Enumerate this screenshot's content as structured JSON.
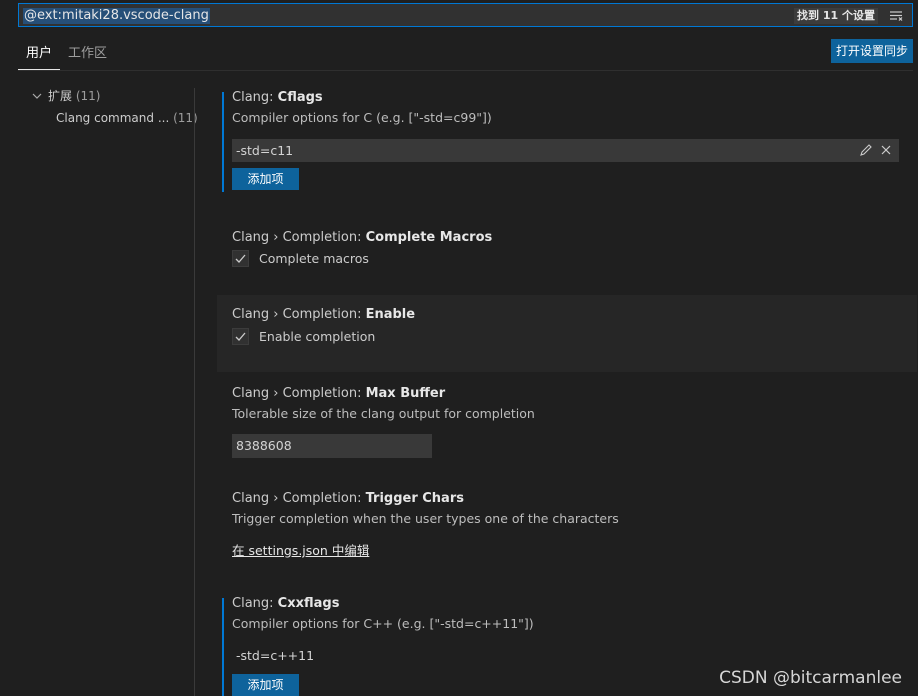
{
  "search": {
    "query": "@ext:mitaki28.vscode-clang",
    "result_count": "找到 11 个设置",
    "filter_icon": "filter-list-icon"
  },
  "tabs": {
    "user": "用户",
    "workspace": "工作区"
  },
  "sync_button": "打开设置同步",
  "toc": {
    "group_label": "扩展",
    "group_count": "(11)",
    "item_label": "Clang command ...",
    "item_count": "(11)"
  },
  "settings": {
    "cflags": {
      "category": "Clang: ",
      "name": "Cflags",
      "description": "Compiler options for C (e.g. [\"-std=c99\"])",
      "items": [
        "-std=c11"
      ],
      "add_label": "添加项"
    },
    "complete_macros": {
      "category": "Clang › Completion: ",
      "name": "Complete Macros",
      "checkbox_label": "Complete macros",
      "checked": true
    },
    "enable": {
      "category": "Clang › Completion: ",
      "name": "Enable",
      "checkbox_label": "Enable completion",
      "checked": true
    },
    "max_buffer": {
      "category": "Clang › Completion: ",
      "name": "Max Buffer",
      "description": "Tolerable size of the clang output for completion",
      "value": "8388608"
    },
    "trigger_chars": {
      "category": "Clang › Completion: ",
      "name": "Trigger Chars",
      "description": "Trigger completion when the user types one of the characters",
      "edit_link": "在 settings.json 中编辑"
    },
    "cxxflags": {
      "category": "Clang: ",
      "name": "Cxxflags",
      "description": "Compiler options for C++ (e.g. [\"-std=c++11\"])",
      "items": [
        "-std=c++11"
      ],
      "add_label": "添加项"
    }
  },
  "watermark": "CSDN @bitcarmanlee",
  "colors": {
    "accent": "#0078d4",
    "button": "#0e639c",
    "background": "#1f1f1f"
  }
}
